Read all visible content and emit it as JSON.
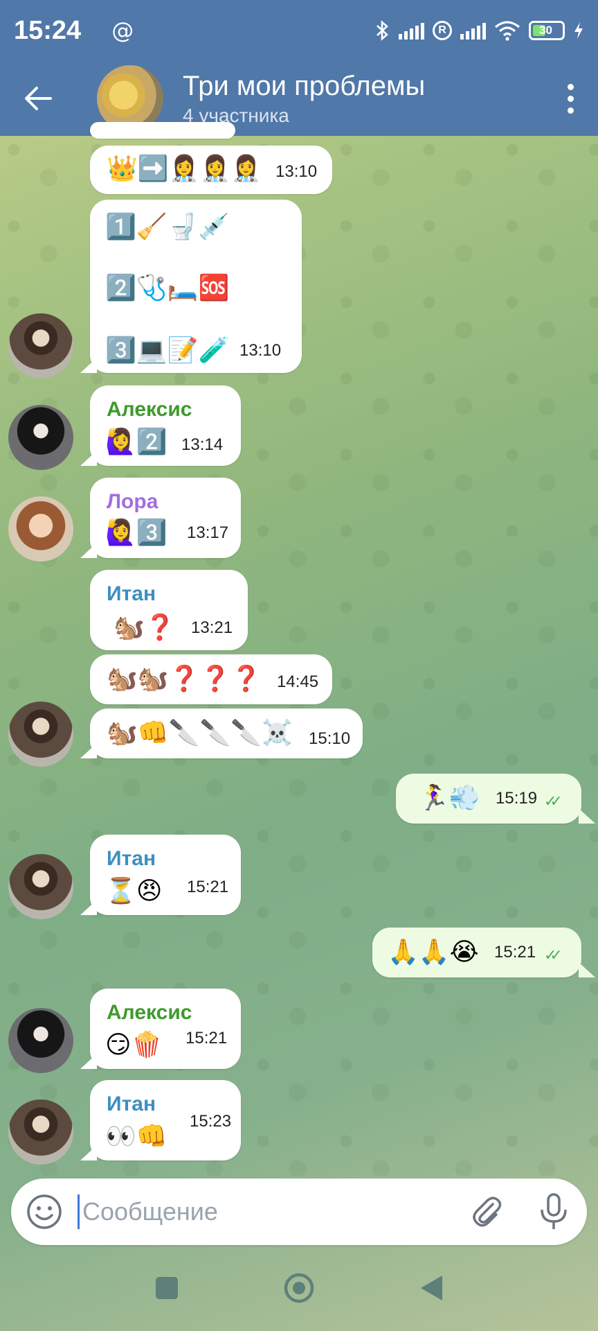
{
  "status_bar": {
    "time": "15:24",
    "at_symbol": "@",
    "registered_symbol": "R",
    "battery_level": "30",
    "icons": [
      "bluetooth-icon",
      "signal-icon",
      "wifi-icon",
      "battery-icon",
      "charging-icon"
    ]
  },
  "header": {
    "title": "Три мои проблемы",
    "subtitle": "4 участника"
  },
  "colors": {
    "header_bg": "#5078a8",
    "name_alexis": "#3f9a2c",
    "name_lora": "#a36ee0",
    "name_etan": "#3d8fc0",
    "checks": "#4caf50"
  },
  "messages": [
    {
      "emoji": "👑➡️👩‍⚕️👩‍⚕️👩‍⚕️",
      "time": "13:10"
    },
    {
      "lines": [
        "1️⃣🧹🚽💉",
        "2️⃣🩺🛏️🆘",
        "3️⃣💻📝🧪"
      ],
      "time": "13:10"
    },
    {
      "sender": "Алексис",
      "emoji": "🙋‍♀️2️⃣",
      "time": "13:14"
    },
    {
      "sender": "Лора",
      "emoji": "🙋‍♀️3️⃣",
      "time": "13:17"
    },
    {
      "sender": "Итан",
      "emoji": "🐿️❓",
      "time": "13:21"
    },
    {
      "emoji": "🐿️🐿️❓❓❓",
      "time": "14:45"
    },
    {
      "emoji": "🐿️👊🔪🔪🔪☠️",
      "time": "15:10"
    },
    {
      "emoji": "🏃‍♀️💨",
      "time": "15:19",
      "outgoing": true
    },
    {
      "sender": "Итан",
      "emoji": "⏳😠",
      "time": "15:21"
    },
    {
      "emoji": "🙏🙏😭",
      "time": "15:21",
      "outgoing": true
    },
    {
      "sender": "Алексис",
      "emoji": "😏🍿",
      "time": "15:21"
    },
    {
      "sender": "Итан",
      "emoji": "👀👊",
      "time": "15:23"
    }
  ],
  "input": {
    "placeholder": "Сообщение"
  }
}
